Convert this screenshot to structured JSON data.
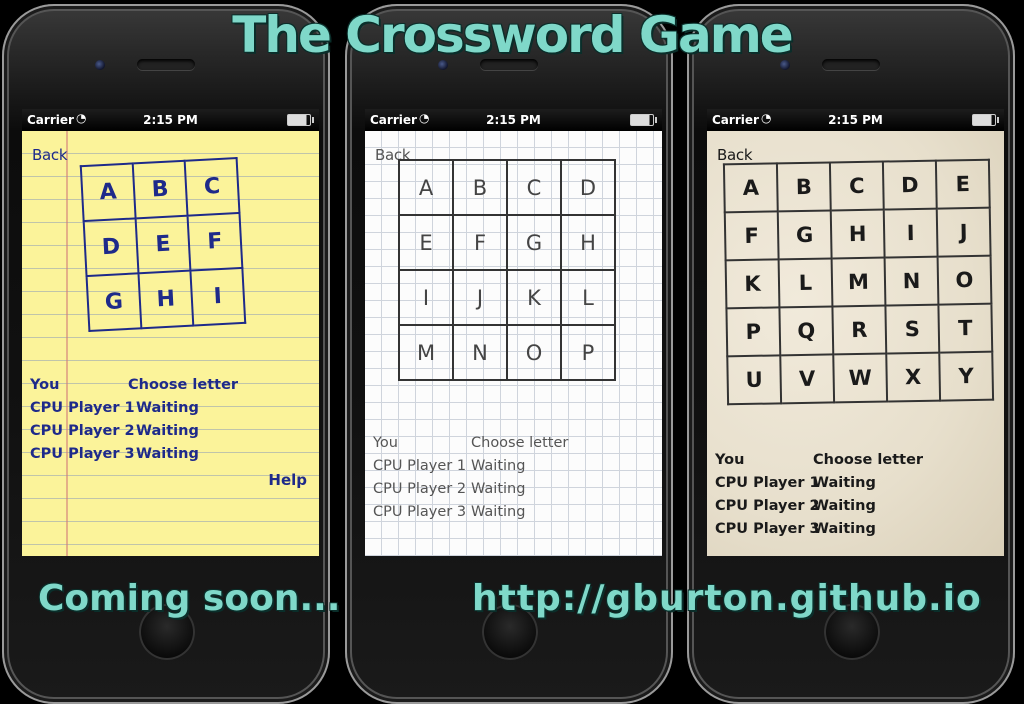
{
  "headline": "The Crossword Game",
  "footer": {
    "coming_soon": "Coming soon...",
    "url": "http://gburton.github.io"
  },
  "statusbar": {
    "carrier": "Carrier",
    "time": "2:15 PM"
  },
  "screens": [
    {
      "theme": "yellow-notepad",
      "back_label": "Back",
      "help_label": "Help",
      "board": [
        [
          "A",
          "B",
          "C"
        ],
        [
          "D",
          "E",
          "F"
        ],
        [
          "G",
          "H",
          "I"
        ]
      ],
      "players": [
        {
          "name": "You",
          "status": "Choose letter"
        },
        {
          "name": "CPU Player 1",
          "status": "Waiting"
        },
        {
          "name": "CPU Player 2",
          "status": "Waiting"
        },
        {
          "name": "CPU Player 3",
          "status": "Waiting"
        }
      ]
    },
    {
      "theme": "graph-paper",
      "back_label": "Back",
      "board": [
        [
          "A",
          "B",
          "C",
          "D"
        ],
        [
          "E",
          "F",
          "G",
          "H"
        ],
        [
          "I",
          "J",
          "K",
          "L"
        ],
        [
          "M",
          "N",
          "O",
          "P"
        ]
      ],
      "players": [
        {
          "name": "You",
          "status": "Choose letter"
        },
        {
          "name": "CPU Player 1",
          "status": "Waiting"
        },
        {
          "name": "CPU Player 2",
          "status": "Waiting"
        },
        {
          "name": "CPU Player 3",
          "status": "Waiting"
        }
      ]
    },
    {
      "theme": "parchment",
      "back_label": "Back",
      "board": [
        [
          "A",
          "B",
          "C",
          "D",
          "E"
        ],
        [
          "F",
          "G",
          "H",
          "I",
          "J"
        ],
        [
          "K",
          "L",
          "M",
          "N",
          "O"
        ],
        [
          "P",
          "Q",
          "R",
          "S",
          "T"
        ],
        [
          "U",
          "V",
          "W",
          "X",
          "Y"
        ]
      ],
      "players": [
        {
          "name": "You",
          "status": "Choose letter"
        },
        {
          "name": "CPU Player 1",
          "status": "Waiting"
        },
        {
          "name": "CPU Player 2",
          "status": "Waiting"
        },
        {
          "name": "CPU Player 3",
          "status": "Waiting"
        }
      ]
    }
  ],
  "colors": {
    "headline": "#7fd8c9",
    "yellow_ink": "#1e2a8a",
    "yellow_paper": "#fbf39a"
  }
}
